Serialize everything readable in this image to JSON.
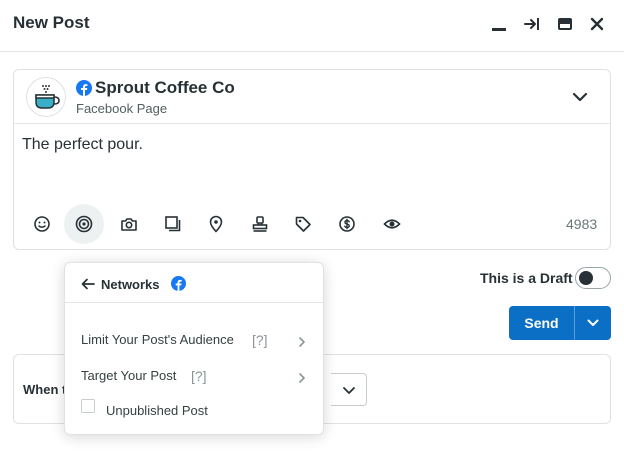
{
  "window": {
    "title": "New Post",
    "controls": [
      "minimize-icon",
      "collapse-to-side-icon",
      "maximize-icon",
      "close-icon"
    ]
  },
  "profile": {
    "network_icon": "facebook-icon",
    "name": "Sprout Coffee Co",
    "type": "Facebook Page",
    "avatar_icon": "coffee-cup-logo"
  },
  "composer": {
    "text": "The perfect pour.",
    "char_count": "4983",
    "tools": [
      "emoji-icon",
      "targeting-icon",
      "camera-icon",
      "gallery-icon",
      "location-icon",
      "stamp-icon",
      "tag-icon",
      "dollar-icon",
      "preview-icon"
    ]
  },
  "draft": {
    "label": "This is a Draft",
    "enabled": false
  },
  "send": {
    "label": "Send"
  },
  "schedule": {
    "when_label": "When t"
  },
  "networks_popover": {
    "title": "Networks",
    "items": [
      {
        "label": "Limit Your Post's Audience",
        "help": "[?]"
      },
      {
        "label": "Target Your Post",
        "help": "[?]"
      }
    ],
    "checkbox_label": "Unpublished Post",
    "checkbox_checked": false
  },
  "colors": {
    "accent": "#0b6fc6",
    "facebook": "#1877f2",
    "text": "#273135",
    "border": "#dfe2e4"
  }
}
